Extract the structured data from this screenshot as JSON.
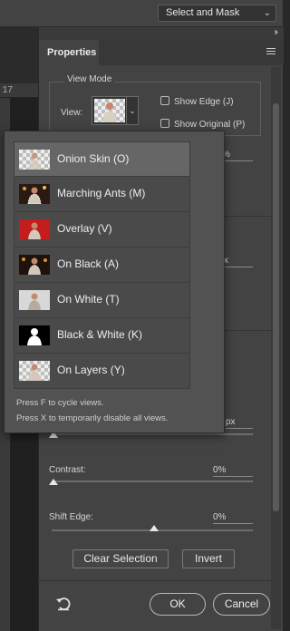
{
  "topbar": {
    "workspace_select": "Select and Mask",
    "chevron_icon": "chevron-down-icon"
  },
  "ruler": {
    "number": "17"
  },
  "panel": {
    "collapse_icon": "double-chevron-right-icon",
    "tab": "Properties",
    "menu_icon": "panel-menu-icon"
  },
  "view_mode": {
    "title": "View Mode",
    "view_label": "View:",
    "show_edge": "Show Edge (J)",
    "show_original": "Show Original (P)"
  },
  "hidden_fields": {
    "percent_right": "%",
    "px_right": "x",
    "px_value": "px"
  },
  "sliders": {
    "contrast_label": "Contrast:",
    "contrast_value": "0%",
    "shift_label": "Shift Edge:",
    "shift_value": "0%"
  },
  "buttons": {
    "clear_selection": "Clear Selection",
    "invert": "Invert",
    "ok": "OK",
    "cancel": "Cancel"
  },
  "view_menu": {
    "items": [
      {
        "label": "Onion Skin (O)",
        "thumb": "onion-skin",
        "selected": true
      },
      {
        "label": "Marching Ants (M)",
        "thumb": "marching-ants",
        "selected": false
      },
      {
        "label": "Overlay (V)",
        "thumb": "overlay",
        "selected": false
      },
      {
        "label": "On Black (A)",
        "thumb": "on-black",
        "selected": false
      },
      {
        "label": "On White (T)",
        "thumb": "on-white",
        "selected": false
      },
      {
        "label": "Black & White (K)",
        "thumb": "black-white",
        "selected": false
      },
      {
        "label": "On Layers (Y)",
        "thumb": "on-layers",
        "selected": false
      }
    ],
    "hint1": "Press F to cycle views.",
    "hint2": "Press X to temporarily disable all views."
  },
  "colors": {
    "panel": "#434343",
    "popup": "#525252",
    "overlay_red": "#c51d1d",
    "selected_row": "#666666"
  }
}
